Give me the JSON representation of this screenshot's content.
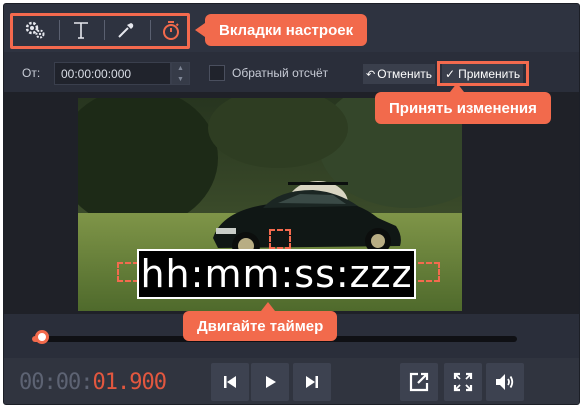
{
  "toolbar": {
    "tabs": [
      {
        "icon": "gears-icon",
        "state": "normal"
      },
      {
        "icon": "text-icon",
        "state": "normal"
      },
      {
        "icon": "color-picker-icon",
        "state": "normal"
      },
      {
        "icon": "stopwatch-icon",
        "state": "active"
      }
    ]
  },
  "callouts": {
    "tabs": "Вкладки настроек",
    "apply": "Принять изменения",
    "move": "Двигайте таймер"
  },
  "controls": {
    "from_label": "От:",
    "from_value": "00:00:00:000",
    "countdown_label": "Обратный отсчёт",
    "countdown_checked": false,
    "cancel_label": "Отменить",
    "apply_label": "Применить"
  },
  "preview": {
    "timer_text": "hh:mm:ss:zzz"
  },
  "playback": {
    "progress": 0.02,
    "timecode_dim": "00:00:",
    "timecode_bright": "01.900"
  },
  "colors": {
    "accent": "#f26a4c",
    "background": "#2a2e3a"
  }
}
